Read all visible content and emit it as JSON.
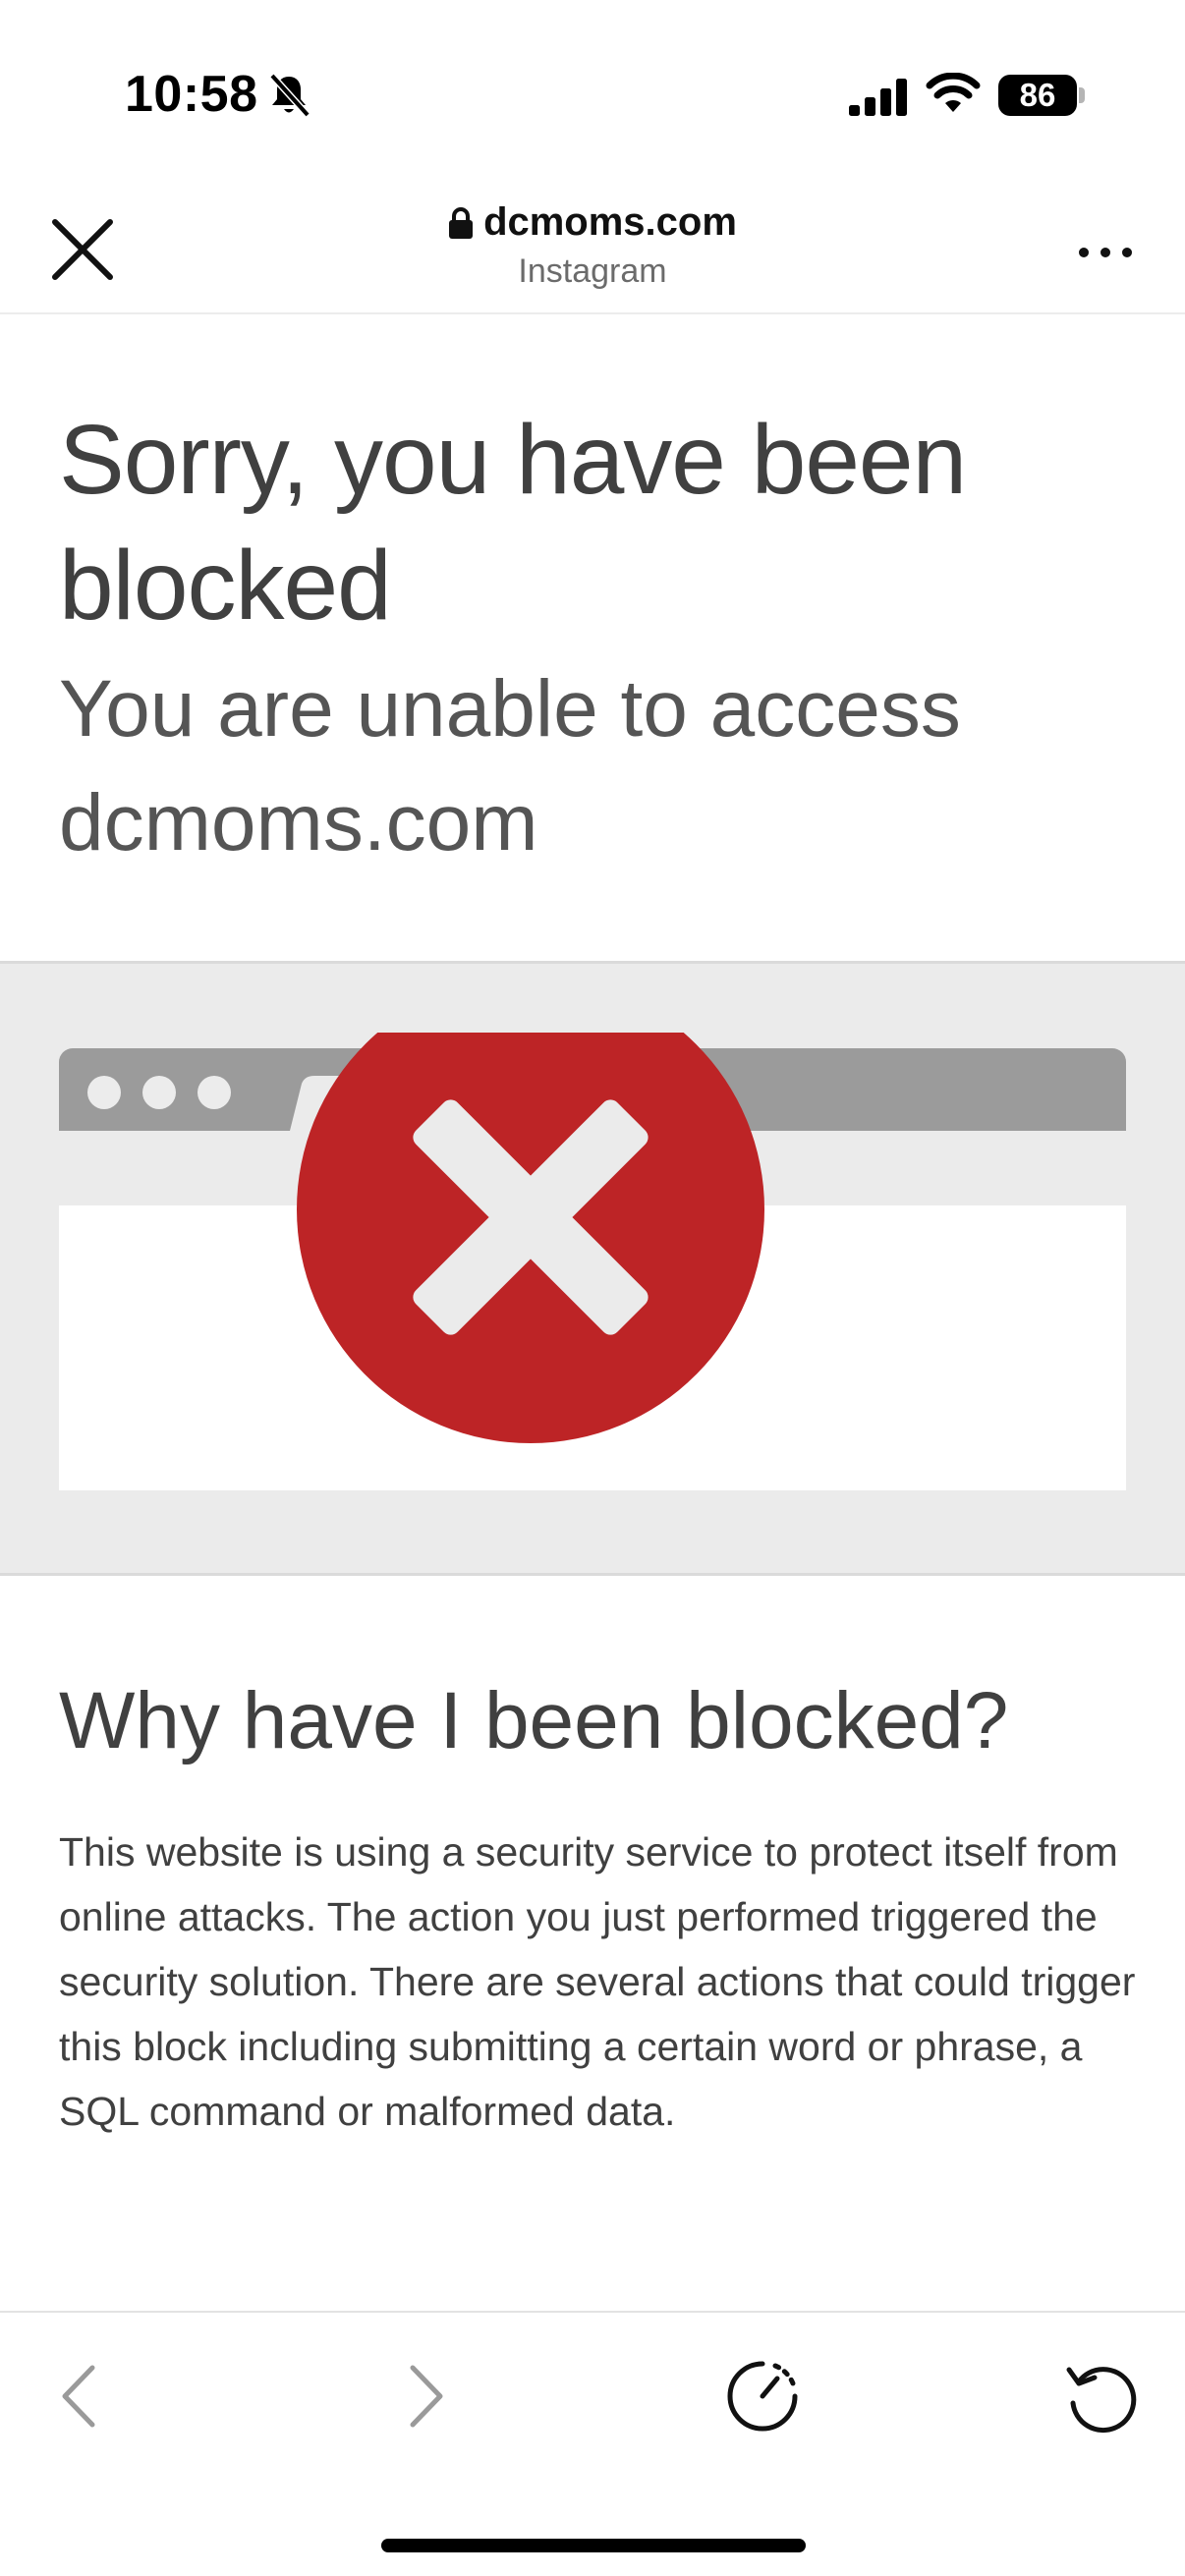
{
  "status_bar": {
    "time": "10:58",
    "battery_level": "86",
    "icons": [
      "bell-muted-icon",
      "signal-icon",
      "wifi-icon",
      "battery-icon"
    ]
  },
  "browser": {
    "domain": "dcmoms.com",
    "source": "Instagram",
    "icons": [
      "close-icon",
      "lock-icon",
      "more-dots-icon"
    ]
  },
  "page": {
    "headline": "Sorry, you have been blocked",
    "subheadline": "You are unable to access dcmoms.com",
    "section_title": "Why have I been blocked?",
    "section_body": "This website is using a security service to protect itself from online attacks. The action you just performed triggered the security solution. There are several actions that could trigger this block including submitting a certain word or phrase, a SQL command or malformed data."
  },
  "toolbar": {
    "icons": [
      "chevron-left-icon",
      "chevron-right-icon",
      "speed-timer-icon",
      "reload-icon"
    ]
  },
  "colors": {
    "block_red": "#bd2426",
    "band_gray": "#ebebeb",
    "bar_gray": "#9b9b9b",
    "text_dark": "#404040"
  }
}
